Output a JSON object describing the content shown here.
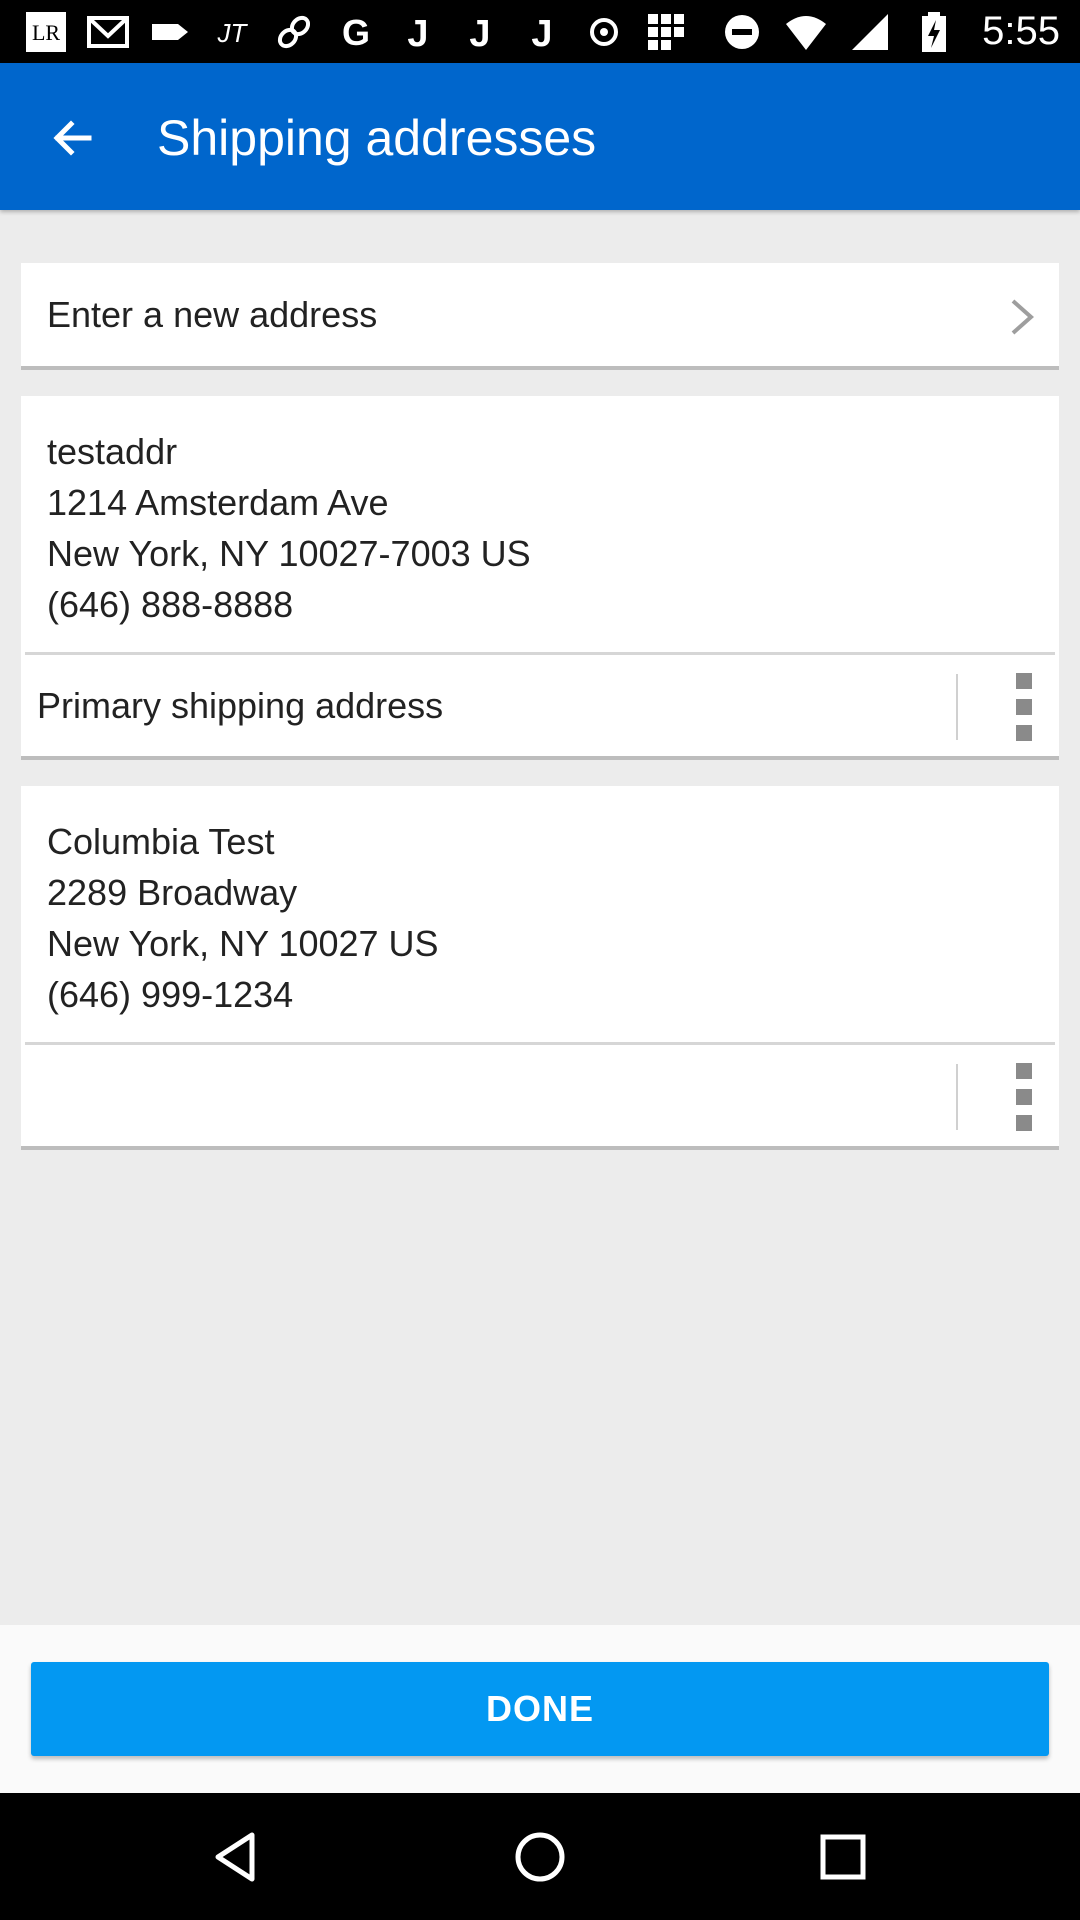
{
  "status_bar": {
    "time": "5:55",
    "left_icons": [
      "lr-app-icon",
      "gmail-icon",
      "tag-icon",
      "jt-app-icon",
      "link-icon",
      "google-icon",
      "j-icon",
      "j-icon",
      "j-icon",
      "target-icon",
      "grid-icon"
    ],
    "right_icons": [
      "do-not-disturb-icon",
      "wifi-icon",
      "signal-icon",
      "battery-charging-icon"
    ]
  },
  "header": {
    "title": "Shipping addresses",
    "back_icon": "arrow-back-icon"
  },
  "new_address": {
    "label": "Enter a new address",
    "icon": "chevron-right-icon"
  },
  "addresses": [
    {
      "name": "testaddr",
      "street": "1214 Amsterdam Ave",
      "city_line": "New York, NY 10027-7003 US",
      "phone": "(646) 888-8888",
      "footer_label": "Primary shipping address"
    },
    {
      "name": "Columbia Test",
      "street": "2289 Broadway",
      "city_line": "New York, NY 10027 US",
      "phone": "(646) 999-1234",
      "footer_label": ""
    }
  ],
  "footer": {
    "done_label": "DONE"
  },
  "nav_bar": {
    "icons": [
      "nav-back-icon",
      "nav-home-icon",
      "nav-recents-icon"
    ]
  },
  "colors": {
    "app_bar": "#0066cc",
    "done_button": "#0398f2",
    "background": "#ececec"
  }
}
